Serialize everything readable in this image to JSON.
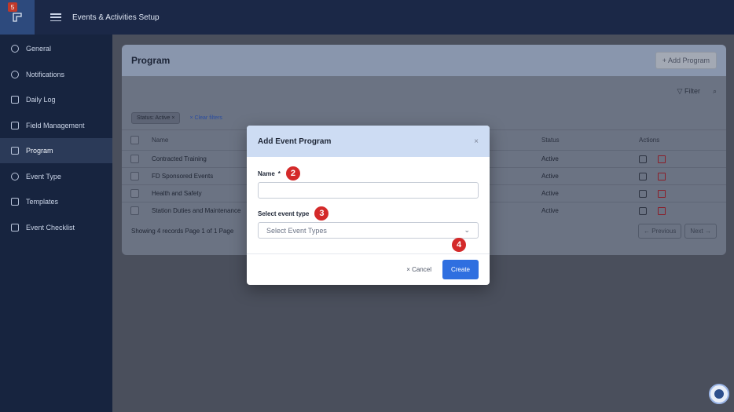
{
  "topbar": {
    "badge": "5",
    "title": "Events & Activities Setup"
  },
  "sidebar": {
    "items": [
      {
        "label": "General",
        "icon": "gear-icon"
      },
      {
        "label": "Notifications",
        "icon": "bell-icon"
      },
      {
        "label": "Daily Log",
        "icon": "log-icon"
      },
      {
        "label": "Field Management",
        "icon": "list-icon"
      },
      {
        "label": "Program",
        "icon": "folder-icon",
        "active": true
      },
      {
        "label": "Event Type",
        "icon": "tag-icon"
      },
      {
        "label": "Templates",
        "icon": "file-icon"
      },
      {
        "label": "Event Checklist",
        "icon": "checklist-icon"
      }
    ]
  },
  "program": {
    "title": "Program",
    "add_label": "+ Add Program",
    "filter_label": "Filter",
    "chip_label": "Status: Active",
    "clear_label": "Clear filters",
    "columns": {
      "name": "Name",
      "status": "Status",
      "actions": "Actions"
    },
    "rows": [
      {
        "name": "Contracted Training",
        "status": "Active"
      },
      {
        "name": "FD Sponsored Events",
        "status": "Active"
      },
      {
        "name": "Health and Safety",
        "status": "Active"
      },
      {
        "name": "Station Duties and Maintenance",
        "status": "Active"
      }
    ],
    "footer": {
      "records": "Showing 4 records  Page 1 of 1  Page",
      "previous": "← Previous",
      "next": "Next →"
    }
  },
  "modal": {
    "title": "Add Event Program",
    "close": "×",
    "name_label": "Name",
    "name_required": "*",
    "name_value": "",
    "type_label": "Select event type",
    "type_placeholder": "Select Event Types",
    "cancel_label": "× Cancel",
    "create_label": "Create",
    "steps": [
      "2",
      "3",
      "4"
    ]
  },
  "colors": {
    "accent": "#2f6fe0",
    "step": "#d42a2a",
    "header": "#cddcf3"
  }
}
